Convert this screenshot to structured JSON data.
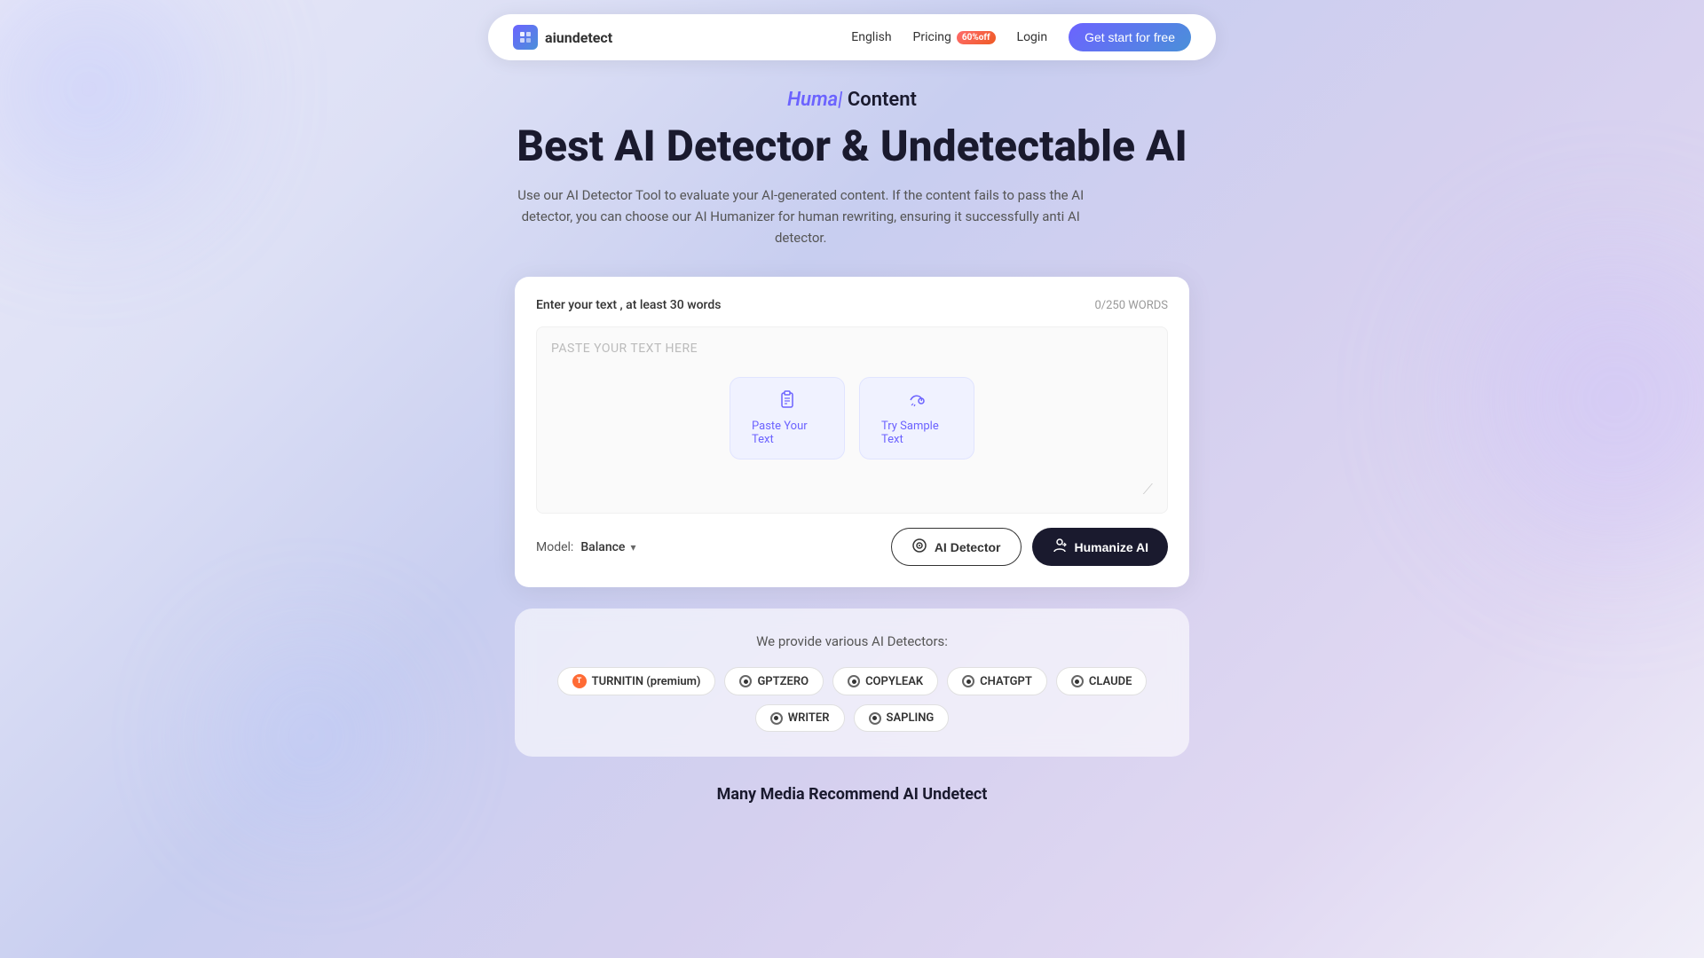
{
  "navbar": {
    "logo_text": "aiundetect",
    "nav_english": "English",
    "nav_pricing": "Pricing",
    "pricing_badge": "60%off",
    "nav_login": "Login",
    "nav_get_start": "Get start for free"
  },
  "hero": {
    "subtitle_human": "Huma|",
    "subtitle_content": "Content",
    "title": "Best AI Detector & Undetectable AI",
    "description": "Use our AI Detector Tool to evaluate your AI-generated content. If the content fails to pass the AI detector, you can choose our AI Humanizer for human rewriting, ensuring it successfully anti AI detector."
  },
  "text_area": {
    "label": "Enter your text , at least 30 words",
    "word_count": "0/250 WORDS",
    "placeholder": "PASTE YOUR TEXT HERE",
    "paste_label": "Paste Your Text",
    "sample_label": "Try Sample Text"
  },
  "controls": {
    "model_label": "Model:",
    "model_value": "Balance",
    "ai_detector_label": "AI Detector",
    "humanize_label": "Humanize AI"
  },
  "detectors": {
    "title": "We provide various AI Detectors:",
    "chips": [
      {
        "id": "turnitin",
        "label": "TURNITIN (premium)",
        "icon_type": "turnitin"
      },
      {
        "id": "gptzero",
        "label": "GPTZERO",
        "icon_type": "circle"
      },
      {
        "id": "copyleak",
        "label": "COPYLEAK",
        "icon_type": "circle"
      },
      {
        "id": "chatgpt",
        "label": "CHATGPT",
        "icon_type": "circle"
      },
      {
        "id": "claude",
        "label": "CLAUDE",
        "icon_type": "circle"
      },
      {
        "id": "writer",
        "label": "WRITER",
        "icon_type": "circle"
      },
      {
        "id": "sapling",
        "label": "SAPLING",
        "icon_type": "circle"
      }
    ]
  },
  "recommend": {
    "text": "Many Media Recommend AI Undetect"
  }
}
